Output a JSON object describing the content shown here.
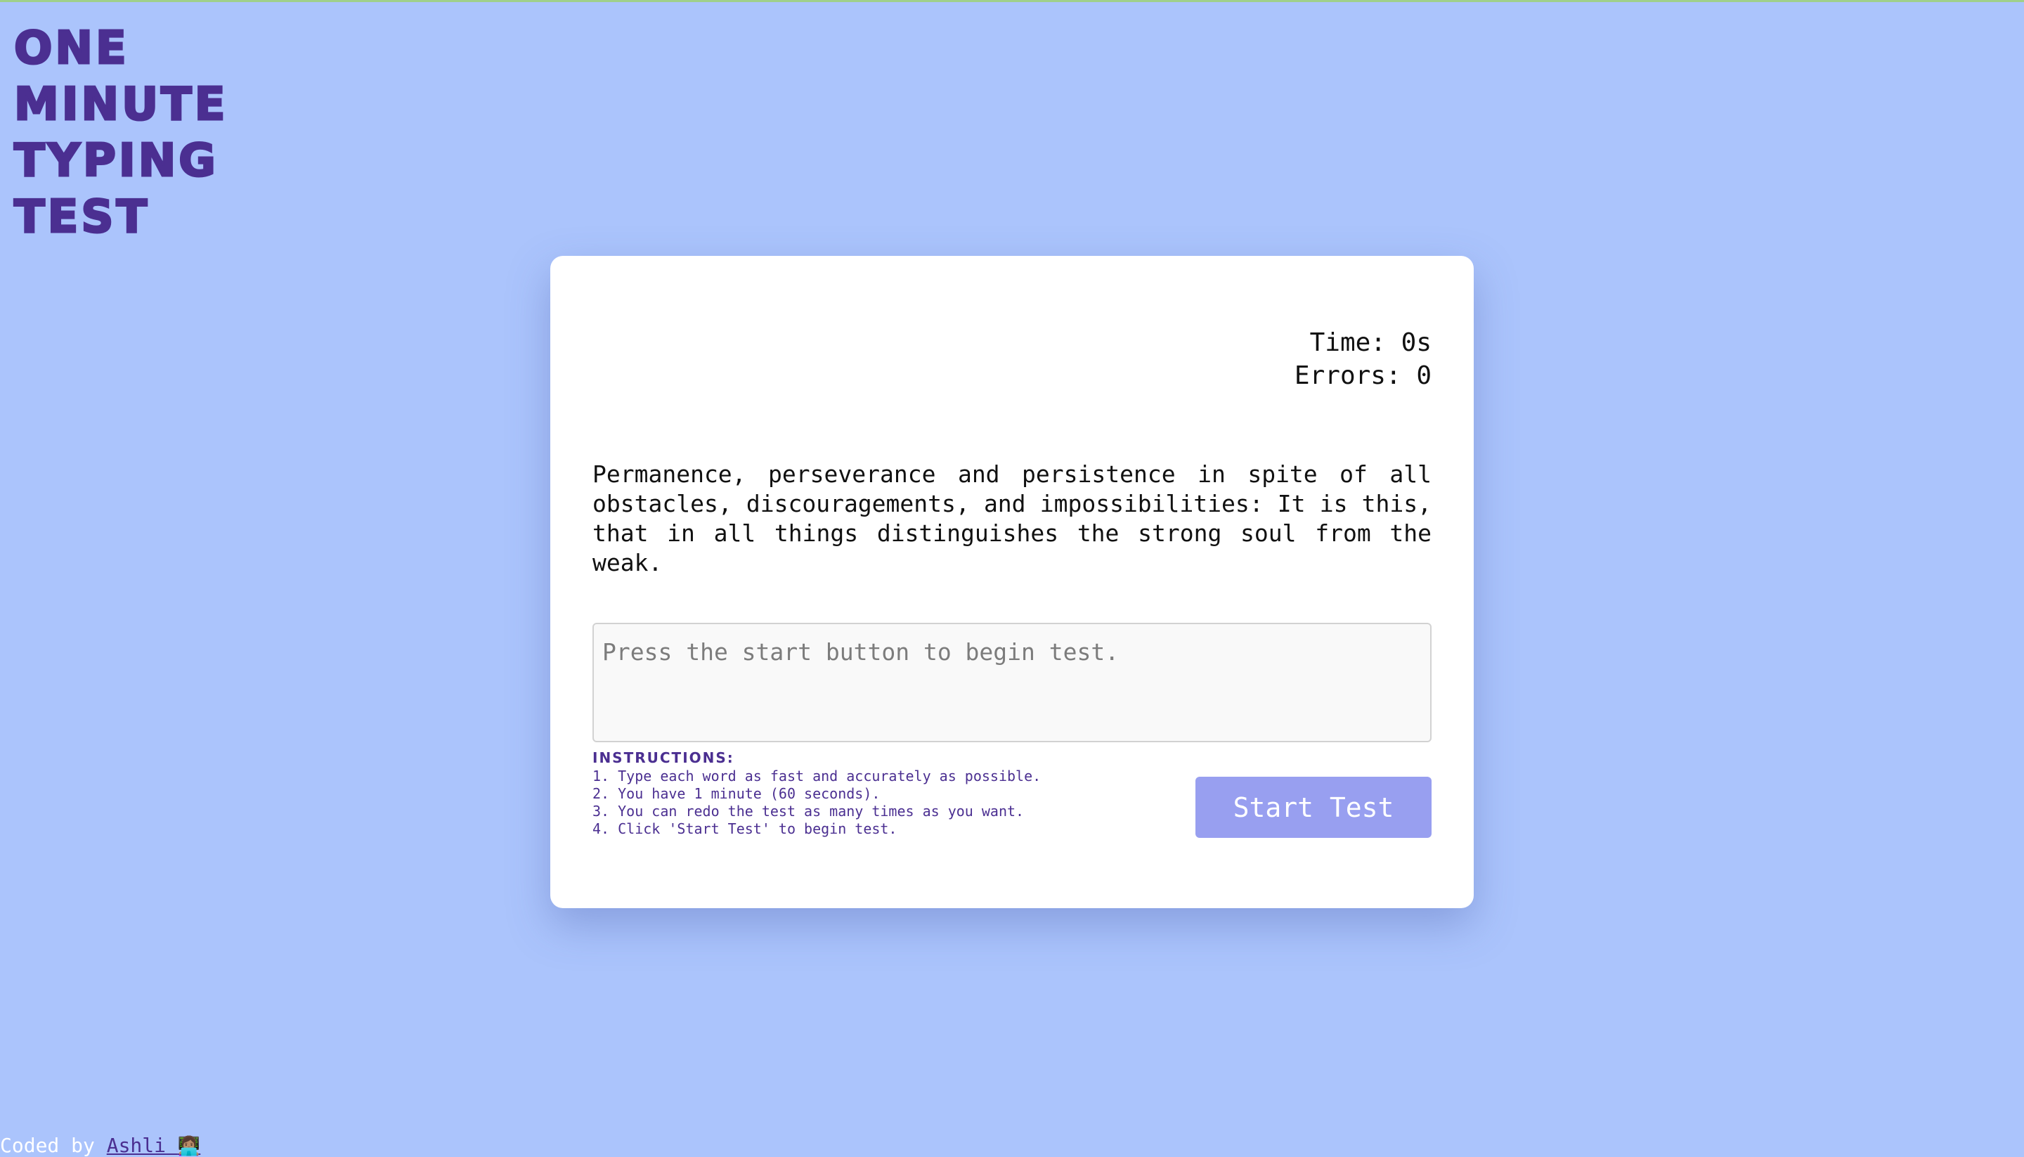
{
  "logo": {
    "line1": "ONE",
    "line2": "MINUTE",
    "line3": "TYPING",
    "line4": "TEST"
  },
  "stats": {
    "time": "Time: 0s",
    "errors": "Errors: 0"
  },
  "quote": "Permanence, perseverance and persistence in spite of all obstacles, discouragements, and impossibilities: It is this, that in all things distinguishes the strong soul from the weak.",
  "input": {
    "value": "",
    "placeholder": "Press the start button to begin test."
  },
  "instructions": {
    "title": "INSTRUCTIONS:",
    "items": [
      "1. Type each word as fast and accurately as possible.",
      "2. You have 1 minute (60 seconds).",
      "3. You can redo the test as many times as you want.",
      "4. Click 'Start Test' to begin test."
    ]
  },
  "start_button": "Start Test",
  "footer": {
    "prefix": "Coded by ",
    "author": "Ashli",
    "author_emoji": "👩🏽‍💻"
  },
  "colors": {
    "background": "#abc4fc",
    "accent": "#4b2f91",
    "button": "#989ff0",
    "card": "#ffffff"
  }
}
